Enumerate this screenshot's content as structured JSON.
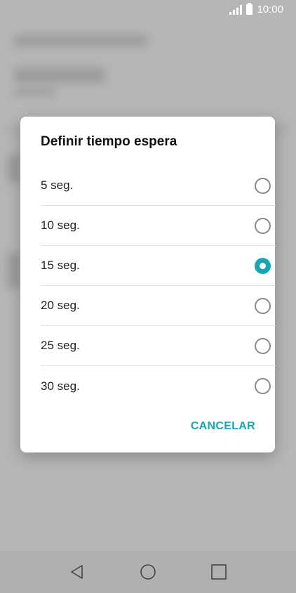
{
  "status_bar": {
    "time": "10:00",
    "signal_icon": "signal-icon",
    "battery_icon": "battery-icon"
  },
  "dialog": {
    "title": "Definir tiempo espera",
    "options": [
      {
        "label": "5 seg.",
        "selected": false
      },
      {
        "label": "10 seg.",
        "selected": false
      },
      {
        "label": "15 seg.",
        "selected": true
      },
      {
        "label": "20 seg.",
        "selected": false
      },
      {
        "label": "25 seg.",
        "selected": false
      },
      {
        "label": "30 seg.",
        "selected": false
      }
    ],
    "cancel_label": "CANCELAR"
  },
  "nav_bar": {
    "back_icon": "back-icon",
    "home_icon": "home-icon",
    "recents_icon": "recents-icon"
  },
  "colors": {
    "accent": "#17a6b8",
    "scrim": "#b6b6b6"
  }
}
